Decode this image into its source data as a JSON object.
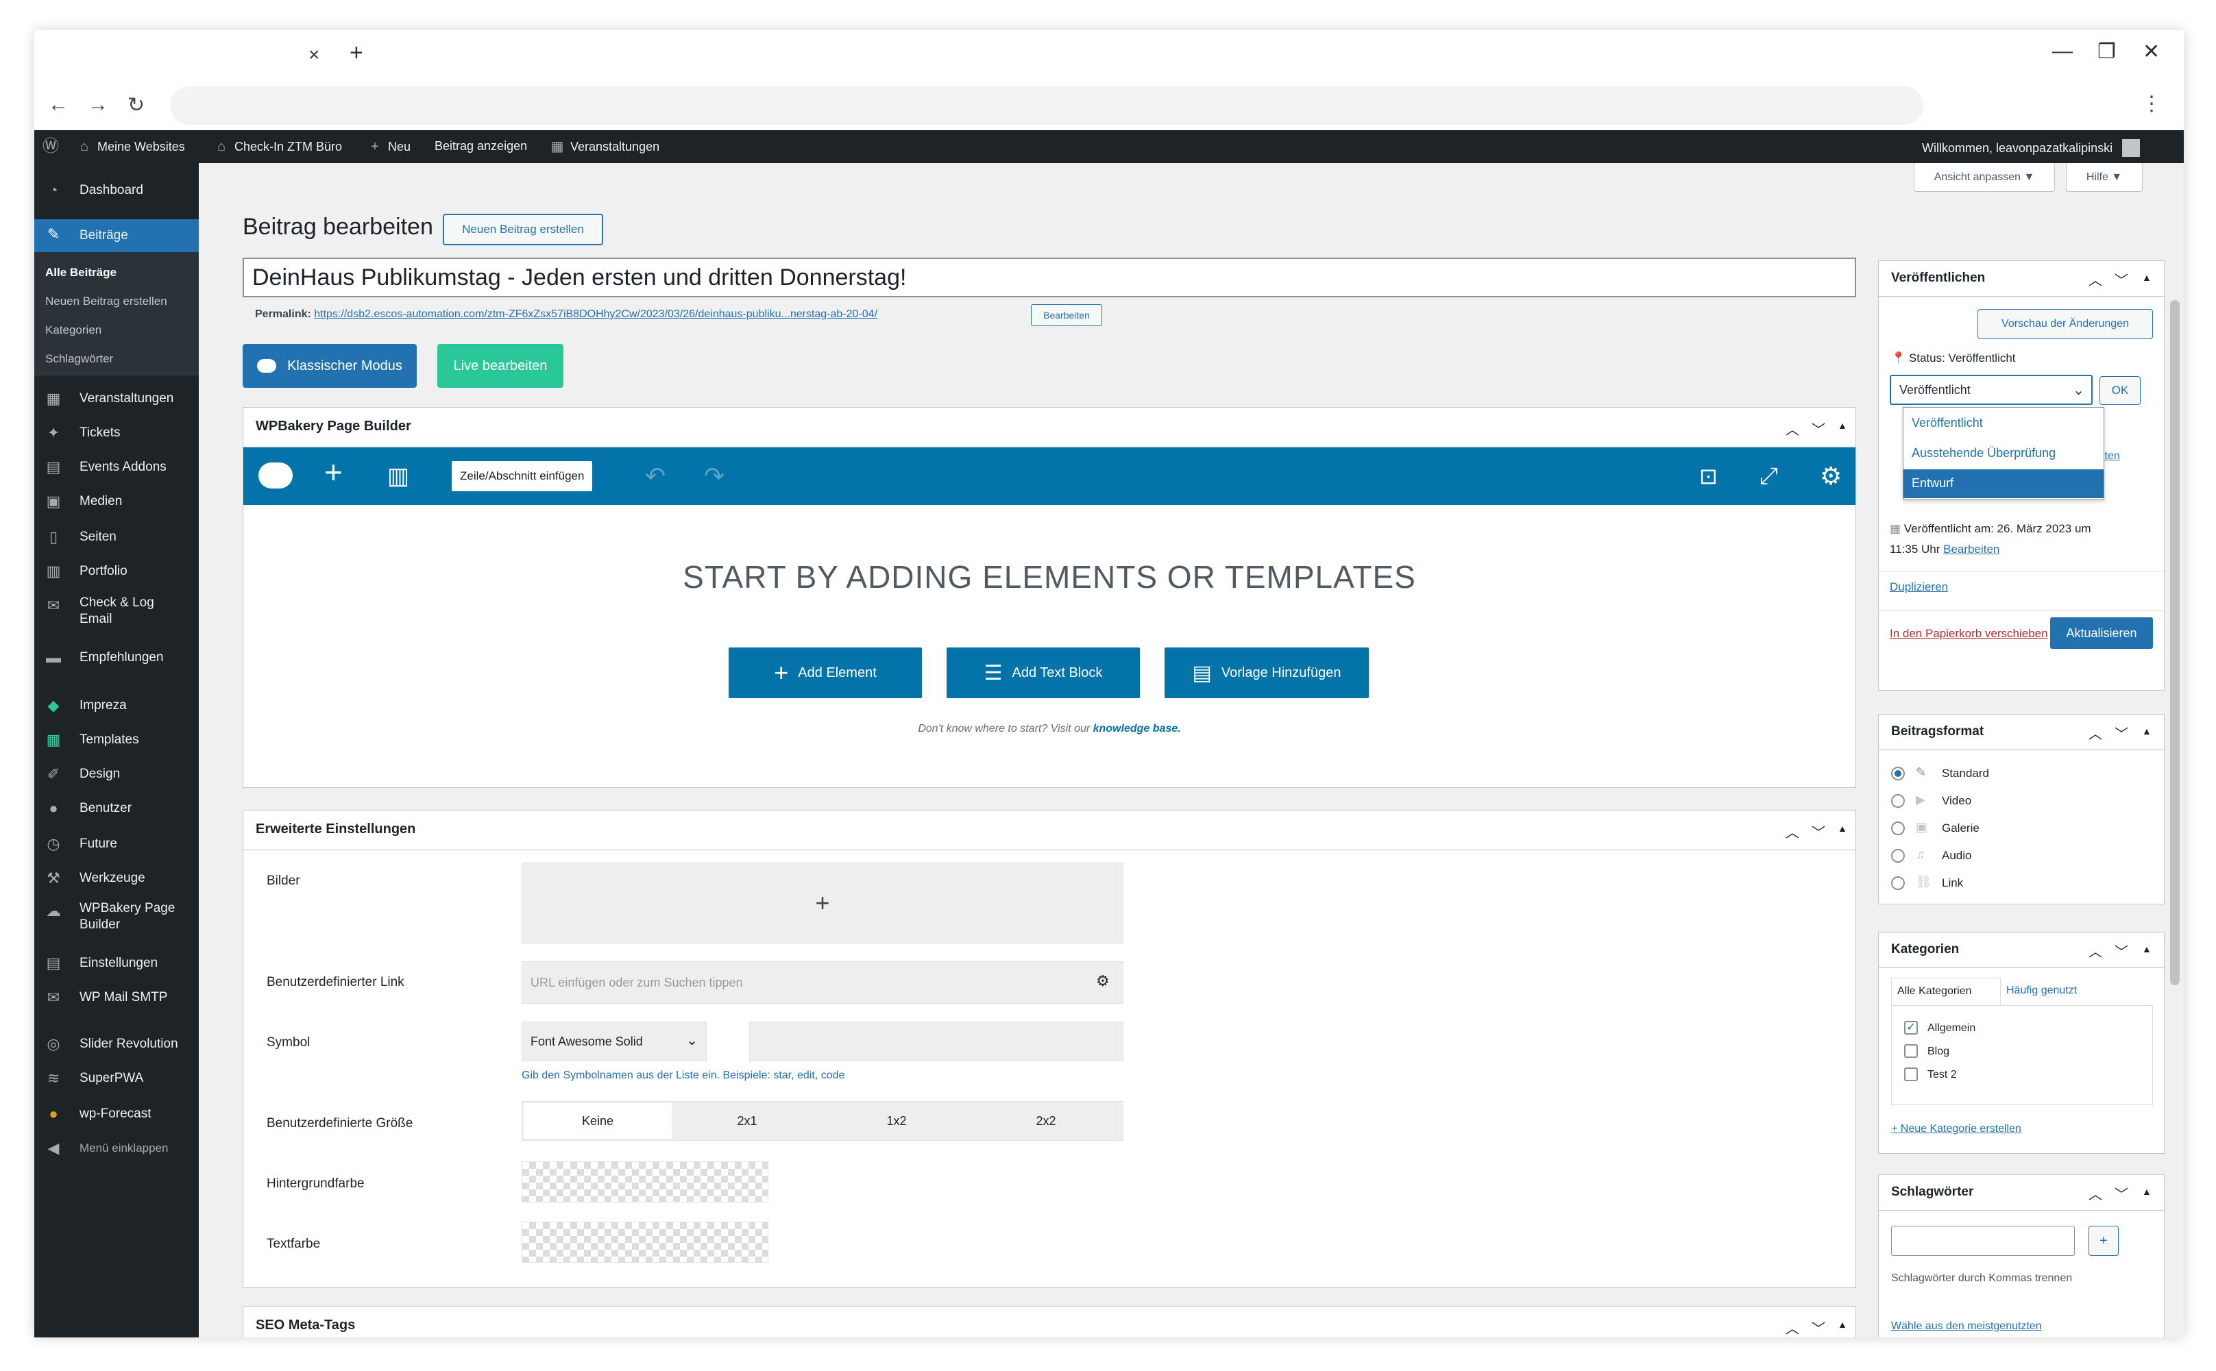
{
  "browser": {
    "tab_close": "×",
    "new_tab": "+",
    "minimize": "—",
    "restore": "❐",
    "close": "✕",
    "back": "←",
    "forward": "→",
    "reload": "↻",
    "menu": "⋮"
  },
  "adminbar": {
    "sites": "Meine Websites",
    "site": "Check-In ZTM Büro",
    "new": "Neu",
    "view_post": "Beitrag anzeigen",
    "events": "Veranstaltungen",
    "greeting": "Willkommen, leavonpazatkalipinski"
  },
  "sidebar": {
    "items": [
      {
        "label": "Dashboard",
        "icon": "dashboard-icon"
      },
      {
        "label": "Beiträge",
        "icon": "pin-icon"
      },
      {
        "label": "Veranstaltungen",
        "icon": "calendar-icon"
      },
      {
        "label": "Tickets",
        "icon": "ticket-icon"
      },
      {
        "label": "Events Addons",
        "icon": "grid-icon"
      },
      {
        "label": "Medien",
        "icon": "media-icon"
      },
      {
        "label": "Seiten",
        "icon": "page-icon"
      },
      {
        "label": "Portfolio",
        "icon": "portfolio-icon"
      },
      {
        "label": "Check & Log Email",
        "icon": "email-icon"
      },
      {
        "label": "Empfehlungen",
        "icon": "comment-icon"
      },
      {
        "label": "Impreza",
        "icon": "diamond-icon"
      },
      {
        "label": "Templates",
        "icon": "template-icon"
      },
      {
        "label": "Design",
        "icon": "brush-icon"
      },
      {
        "label": "Benutzer",
        "icon": "user-icon"
      },
      {
        "label": "Future",
        "icon": "clock-icon"
      },
      {
        "label": "Werkzeuge",
        "icon": "wrench-icon"
      },
      {
        "label": "WPBakery Page Builder",
        "icon": "cloud-icon"
      },
      {
        "label": "Einstellungen",
        "icon": "settings-icon"
      },
      {
        "label": "WP Mail SMTP",
        "icon": "mail-icon"
      },
      {
        "label": "Slider Revolution",
        "icon": "revolution-icon"
      },
      {
        "label": "SuperPWA",
        "icon": "pwa-icon"
      },
      {
        "label": "wp-Forecast",
        "icon": "sun-icon"
      },
      {
        "label": "Menü einklappen",
        "icon": "collapse-icon"
      }
    ],
    "sub": [
      "Alle Beiträge",
      "Neuen Beitrag erstellen",
      "Kategorien",
      "Schlagwörter"
    ]
  },
  "screen_options": "Ansicht anpassen ▼",
  "help": "Hilfe ▼",
  "page": {
    "heading": "Beitrag bearbeiten",
    "new_post_button": "Neuen Beitrag erstellen",
    "title_value": "DeinHaus Publikumstag - Jeden ersten und dritten Donnerstag!",
    "permalink_label": "Permalink:",
    "permalink_url": "https://dsb2.escos-automation.com/ztm-ZF6xZsx57iB8DOHhy2Cw/2023/03/26/deinhaus-publiku...nerstag-ab-20-04/",
    "permalink_edit": "Bearbeiten",
    "classic_mode": "Klassischer Modus",
    "live_edit": "Live bearbeiten"
  },
  "wpbakery": {
    "title": "WPBakery Page Builder",
    "tooltip": "Zeile/Abschnitt einfügen",
    "headline": "START BY ADDING ELEMENTS OR TEMPLATES",
    "add_element": "Add Element",
    "add_text_block": "Add Text Block",
    "add_template": "Vorlage Hinzufügen",
    "hint": "Don't know where to start? Visit our",
    "hint_link": "knowledge base."
  },
  "advanced": {
    "title": "Erweiterte Einstellungen",
    "images_label": "Bilder",
    "plus": "+",
    "link_label": "Benutzerdefinierter Link",
    "link_placeholder": "URL einfügen oder zum Suchen tippen",
    "symbol_label": "Symbol",
    "symbol_select": "Font Awesome Solid",
    "symbol_hint": "Gib den Symbolnamen aus der Liste ein. Beispiele: star, edit, code",
    "size_label": "Benutzerdefinierte Größe",
    "size_options": [
      "Keine",
      "2x1",
      "1x2",
      "2x2"
    ],
    "bg_label": "Hintergrundfarbe",
    "text_label": "Textfarbe"
  },
  "seo": {
    "title": "SEO Meta-Tags"
  },
  "publish": {
    "title": "Veröffentlichen",
    "preview": "Vorschau der Änderungen",
    "status": "Status: Veröffentlicht",
    "select_value": "Veröffentlicht",
    "ok": "OK",
    "options": [
      "Veröffentlicht",
      "Ausstehende Überprüfung",
      "Entwurf"
    ],
    "hidden_link": "iten",
    "published_on": "Veröffentlicht am: 26. März 2023 um",
    "published_time": "11:35 Uhr",
    "edit": "Bearbeiten",
    "duplicate": "Duplizieren",
    "trash": "In den Papierkorb verschieben",
    "update": "Aktualisieren"
  },
  "format": {
    "title": "Beitragsformat",
    "options": [
      "Standard",
      "Video",
      "Galerie",
      "Audio",
      "Link"
    ]
  },
  "categories": {
    "title": "Kategorien",
    "tab_all": "Alle Kategorien",
    "tab_popular": "Häufig genutzt",
    "items": [
      "Allgemein",
      "Blog",
      "Test 2"
    ],
    "add_new": "+ Neue Kategorie erstellen"
  },
  "tags": {
    "title": "Schlagwörter",
    "add": "+",
    "hint": "Schlagwörter durch Kommas trennen",
    "choose": "Wähle aus den meistgenutzten Schlagwörtern"
  },
  "colors": {
    "wp_blue": "#2271b1",
    "wpb_blue": "#0473aa",
    "live_green": "#2ac898",
    "admin_dark": "#1d2327"
  }
}
